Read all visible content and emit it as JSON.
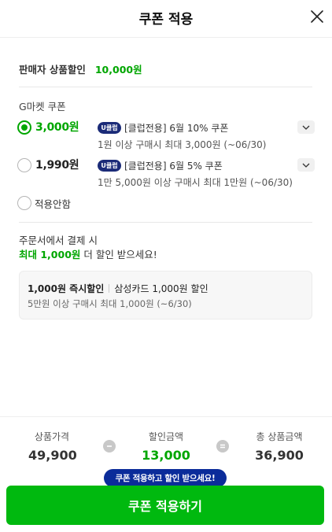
{
  "header": {
    "title": "쿠폰 적용"
  },
  "seller_discount": {
    "label": "판매자 상품할인",
    "amount": "10,000원"
  },
  "gmarket_coupon": {
    "section_label": "G마켓 쿠폰",
    "coupons": [
      {
        "amount": "3,000원",
        "selected": true,
        "badge": "U클럽",
        "title": "[클럽전용] 6월 10% 쿠폰",
        "condition": "1원 이상 구매시 최대 3,000원 (~06/30)"
      },
      {
        "amount": "1,990원",
        "selected": false,
        "badge": "U클럽",
        "title": "[클럽전용] 6월 5% 쿠폰",
        "condition": "1만 5,000원 이상 구매시 최대 1만원 (~06/30)"
      }
    ],
    "no_apply_label": "적용안함"
  },
  "promo": {
    "line1": "주문서에서 결제 시",
    "highlight": "최대 1,000원",
    "line2_rest": " 더 할인 받으세요!"
  },
  "card_offer": {
    "title": "1,000원 즉시할인",
    "card_text": "삼성카드 1,000원 할인",
    "condition": "5만원 이상 구매시 최대 1,000원 (~6/30)"
  },
  "summary": {
    "product_price_label": "상품가격",
    "product_price": "49,900",
    "discount_label": "할인금액",
    "discount": "13,000",
    "total_label": "총 상품금액",
    "total": "36,900"
  },
  "tooltip": "쿠폰 적용하고 할인 받으세요!",
  "apply_button": "쿠폰 적용하기",
  "colors": {
    "accent_green": "#00a600",
    "button_green": "#00b90f",
    "tooltip_blue": "#0b2c9a",
    "badge_navy": "#1b2b78"
  }
}
